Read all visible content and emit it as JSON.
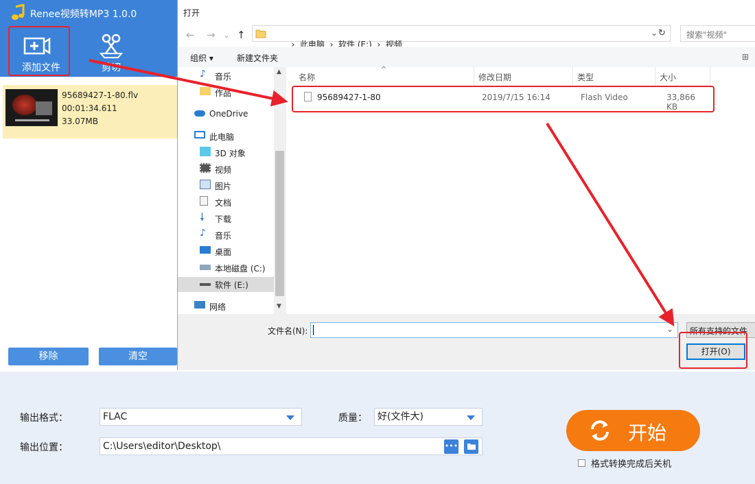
{
  "app": {
    "title": "Renee视频转MP3 1.0.0",
    "toolbar": {
      "add_file": "添加文件",
      "cut": "剪切"
    },
    "file": {
      "name": "95689427-1-80.flv",
      "duration": "00:01:34.611",
      "size": "33.07MB"
    },
    "buttons": {
      "remove": "移除",
      "clear": "清空"
    },
    "output": {
      "format_label": "输出格式：",
      "format_value": "FLAC",
      "quality_label": "质量：",
      "quality_value": "好(文件大)",
      "location_label": "输出位置：",
      "location_value": "C:\\Users\\editor\\Desktop\\",
      "browse_label": "•••"
    },
    "start_label": "开始",
    "shutdown_label": "格式转换完成后关机"
  },
  "dialog": {
    "title": "打开",
    "breadcrumb": {
      "pc": "此电脑",
      "drive": "软件 (E:)",
      "folder": "视频"
    },
    "search_placeholder": "搜索\"视频\"",
    "organize_label": "组织 ▾",
    "new_folder_label": "新建文件夹",
    "tree": {
      "music_top": "音乐",
      "works": "作品",
      "onedrive": "OneDrive",
      "this_pc": "此电脑",
      "objects3d": "3D 对象",
      "videos": "视频",
      "pictures": "图片",
      "documents": "文档",
      "downloads": "下载",
      "music": "音乐",
      "desktop": "桌面",
      "local_c": "本地磁盘 (C:)",
      "soft_e": "软件 (E:)",
      "network": "网络"
    },
    "columns": {
      "name": "名称",
      "modified": "修改日期",
      "type": "类型",
      "size": "大小"
    },
    "files": [
      {
        "name": "95689427-1-80",
        "modified": "2019/7/15 16:14",
        "type": "Flash Video",
        "size": "33,866 KB"
      }
    ],
    "filename_label": "文件名(N):",
    "filename_value": "",
    "filter_value": "所有支持的文件",
    "open_label": "打开(O)"
  },
  "colors": {
    "app_blue": "#3c82d8",
    "start_orange": "#f57a10",
    "highlight_yellow": "#fbeeb8",
    "annotation_red": "#e8222a"
  }
}
